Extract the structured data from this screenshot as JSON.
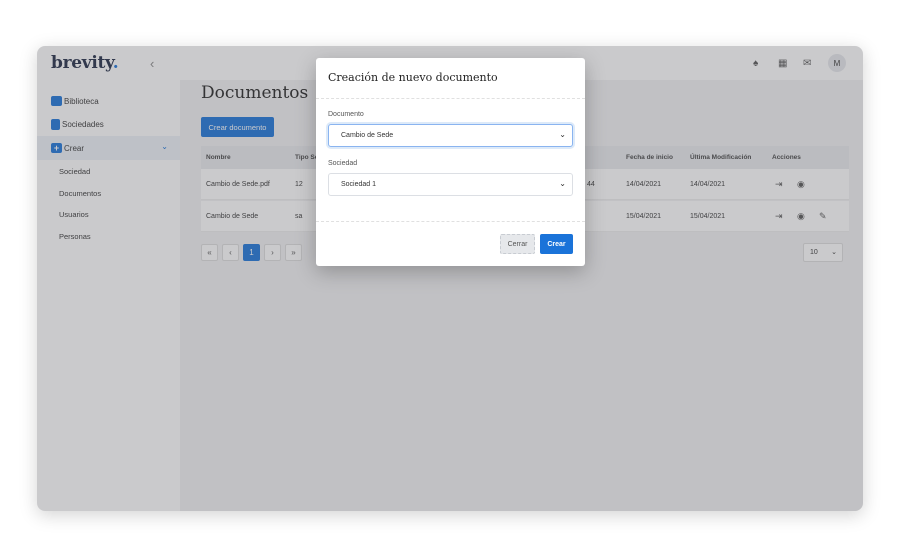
{
  "brand": {
    "name": "brevity",
    "dot": "."
  },
  "sidebar": {
    "collapse_icon": "‹",
    "items": [
      {
        "label": "Biblioteca",
        "icon": "folder-icon"
      },
      {
        "label": "Sociedades",
        "icon": "book-icon"
      },
      {
        "label": "Crear",
        "icon": "plus-icon"
      }
    ],
    "sub_items": [
      {
        "label": "Sociedad"
      },
      {
        "label": "Documentos"
      },
      {
        "label": "Usuarios"
      },
      {
        "label": "Personas"
      }
    ]
  },
  "topbar": {
    "icons": [
      "tree-icon",
      "calendar-icon",
      "mail-icon"
    ],
    "avatar": "M"
  },
  "main": {
    "title": "Documentos",
    "create_button": "Crear documento",
    "table": {
      "columns": [
        "Nombre",
        "Tipo Se",
        "Fecha de inicio",
        "Última Modificación",
        "Acciones"
      ],
      "rows": [
        {
          "nombre": "Cambio de Sede.pdf",
          "tipo": "12",
          "extra": "44",
          "fecha": "14/04/2021",
          "modificacion": "14/04/2021"
        },
        {
          "nombre": "Cambio de Sede",
          "tipo": "sa",
          "extra": "",
          "fecha": "15/04/2021",
          "modificacion": "15/04/2021"
        }
      ]
    },
    "pagination": {
      "first": "«",
      "prev": "‹",
      "current": "1",
      "next": "›",
      "last": "»"
    },
    "per_page": "10"
  },
  "modal": {
    "title": "Creación de nuevo documento",
    "documento_label": "Documento",
    "documento_value": "Cambio de Sede",
    "sociedad_label": "Sociedad",
    "sociedad_value": "Sociedad 1",
    "cancel": "Cerrar",
    "create": "Crear"
  },
  "colors": {
    "accent": "#1a73d9",
    "brand_text": "#1f2a44"
  }
}
